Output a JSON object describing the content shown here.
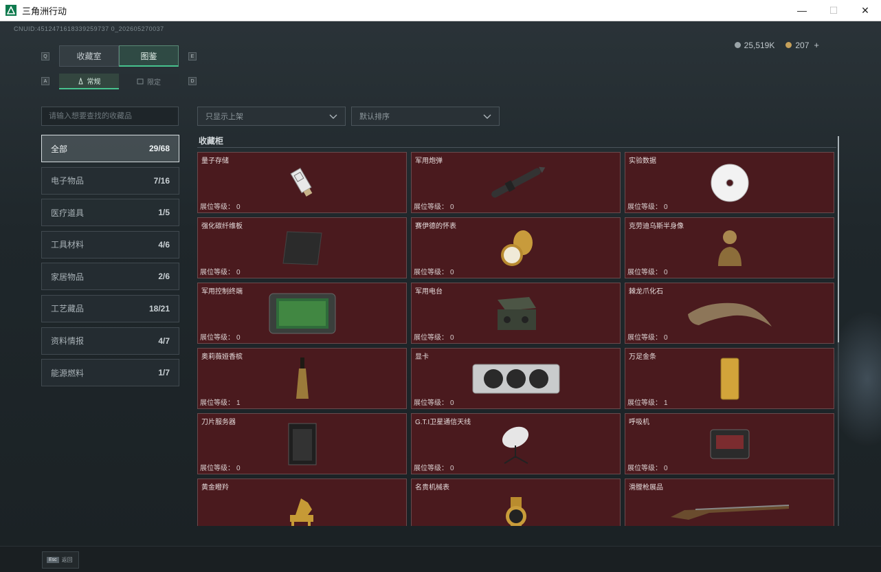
{
  "window": {
    "title": "三角洲行动",
    "icon": "delta-logo-icon",
    "controls": {
      "minimize": "—",
      "maximize": "☐",
      "close": "✕"
    }
  },
  "header": {
    "uid": "CNUID:4512471618339259737 0_202605270037",
    "currency": [
      {
        "icon": "silver-coin-icon",
        "value": "25,519K"
      },
      {
        "icon": "gold-coin-icon",
        "value": "207",
        "action": "+"
      }
    ]
  },
  "key_hints": {
    "prev_tab": "Q",
    "next_tab": "E",
    "prev_sub": "A",
    "next_sub": "D"
  },
  "tabs": [
    {
      "label": "收藏室",
      "active": false
    },
    {
      "label": "图鉴",
      "active": true
    }
  ],
  "subtabs": [
    {
      "label": "常规",
      "icon": "normal-icon",
      "active": true
    },
    {
      "label": "限定",
      "icon": "limited-icon",
      "active": false
    }
  ],
  "search": {
    "placeholder": "请输入想要查找的收藏品",
    "value": ""
  },
  "categories": [
    {
      "label": "全部",
      "count": "29/68",
      "active": true
    },
    {
      "label": "电子物品",
      "count": "7/16"
    },
    {
      "label": "医疗道具",
      "count": "1/5"
    },
    {
      "label": "工具材料",
      "count": "4/6"
    },
    {
      "label": "家居物品",
      "count": "2/6"
    },
    {
      "label": "工艺藏品",
      "count": "18/21"
    },
    {
      "label": "资料情报",
      "count": "4/7"
    },
    {
      "label": "能源燃料",
      "count": "1/7"
    }
  ],
  "filters": {
    "show_only": "只显示上架",
    "sort": "默认排序"
  },
  "section": {
    "title": "收藏柜"
  },
  "level_label": "展位等级：",
  "items": [
    {
      "name": "量子存储",
      "level": "0",
      "icon": "usb-drive-icon"
    },
    {
      "name": "军用炮弹",
      "level": "0",
      "icon": "artillery-shell-icon"
    },
    {
      "name": "实验数据",
      "level": "0",
      "icon": "disc-icon"
    },
    {
      "name": "强化碳纤维板",
      "level": "0",
      "icon": "carbon-plate-icon"
    },
    {
      "name": "赛伊德的怀表",
      "level": "0",
      "icon": "pocket-watch-icon"
    },
    {
      "name": "克劳迪乌斯半身像",
      "level": "0",
      "icon": "bust-icon"
    },
    {
      "name": "军用控制终端",
      "level": "0",
      "icon": "tablet-terminal-icon"
    },
    {
      "name": "军用电台",
      "level": "0",
      "icon": "radio-icon"
    },
    {
      "name": "棘龙爪化石",
      "level": "0",
      "icon": "claw-fossil-icon"
    },
    {
      "name": "奥莉薇娅香槟",
      "level": "1",
      "icon": "champagne-icon"
    },
    {
      "name": "显卡",
      "level": "0",
      "icon": "graphics-card-icon"
    },
    {
      "name": "万足金条",
      "level": "1",
      "icon": "gold-bar-icon"
    },
    {
      "name": "刀片服务器",
      "level": "0",
      "icon": "server-icon"
    },
    {
      "name": "G.T.I卫星通信天线",
      "level": "0",
      "icon": "satellite-dish-icon"
    },
    {
      "name": "呼吸机",
      "level": "0",
      "icon": "ventilator-icon"
    },
    {
      "name": "黄金瞪羚",
      "level": "",
      "icon": "gazelle-icon"
    },
    {
      "name": "名贵机械表",
      "level": "",
      "icon": "wristwatch-icon"
    },
    {
      "name": "滑膛枪展品",
      "level": "",
      "icon": "musket-icon"
    }
  ],
  "footer": {
    "key": "Esc",
    "label": "返回"
  },
  "colors": {
    "accent": "#47c38e",
    "card_bg": "#4a1a1e",
    "card_border": "#6a4a4d"
  }
}
